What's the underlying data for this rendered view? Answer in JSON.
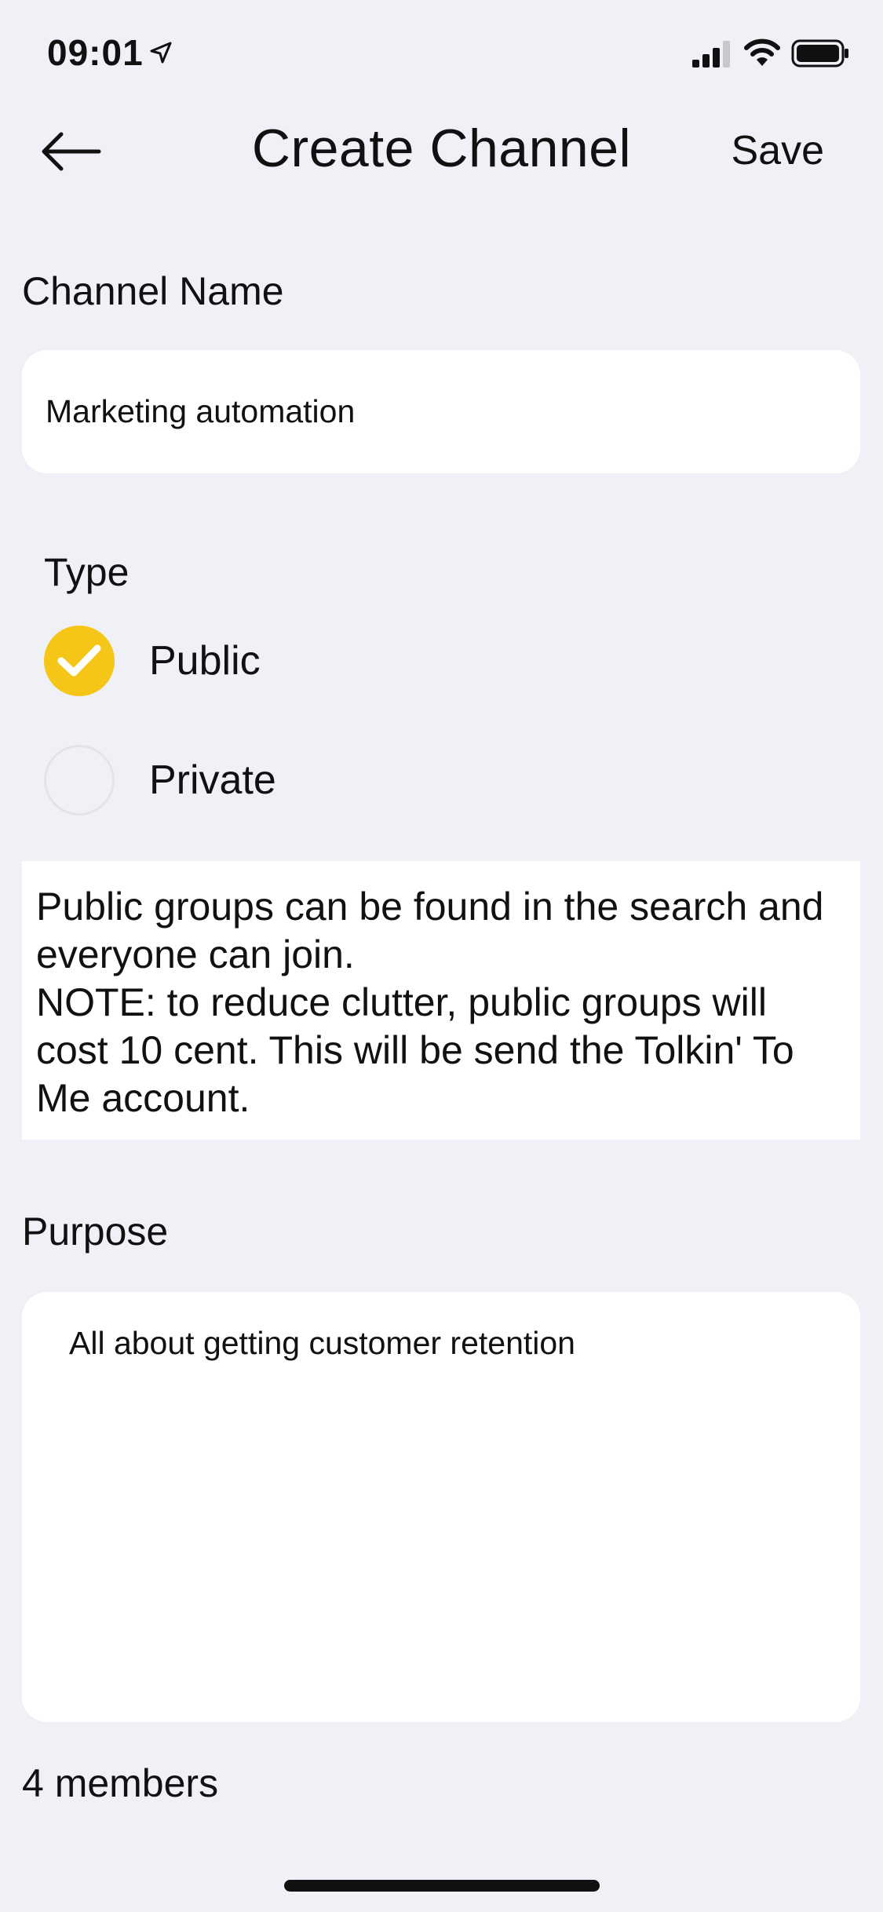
{
  "status_bar": {
    "time": "09:01",
    "icons": [
      "location-icon",
      "signal-icon",
      "wifi-icon",
      "battery-icon"
    ]
  },
  "header": {
    "back_icon": "arrow-left-icon",
    "title": "Create Channel",
    "save_label": "Save"
  },
  "channel_name": {
    "label": "Channel Name",
    "value": "Marketing automation"
  },
  "type": {
    "label": "Type",
    "options": [
      {
        "label": "Public",
        "selected": true
      },
      {
        "label": "Private",
        "selected": false
      }
    ]
  },
  "info": {
    "lines": [
      "Public groups can be found in the search and",
      "everyone can join.",
      "NOTE: to reduce clutter, public groups will",
      "cost 10 cent. This will be send the Tolkin' To",
      "Me account."
    ]
  },
  "purpose": {
    "label": "Purpose",
    "value": "All about getting customer retention"
  },
  "members": {
    "text": "4 members"
  },
  "colors": {
    "background": "#f0f1f6",
    "accent": "#f5c518",
    "card": "#ffffff"
  }
}
